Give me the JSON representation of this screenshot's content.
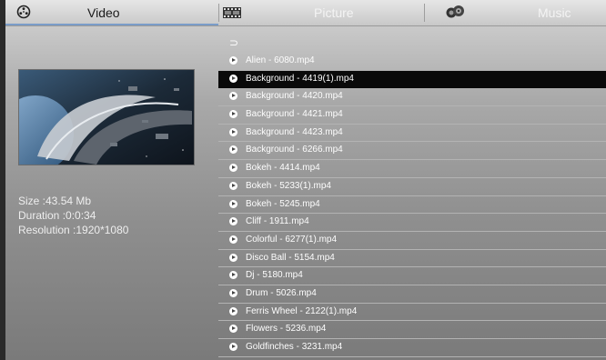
{
  "tabs": [
    {
      "label": "Video",
      "icon": "film-reel-icon",
      "active": true
    },
    {
      "label": "Picture",
      "icon": "film-strip-icon",
      "active": false
    },
    {
      "label": "Music",
      "icon": "speaker-icon",
      "active": false
    }
  ],
  "back_glyph": "⊃",
  "files": [
    "Alien - 6080.mp4",
    "Background - 4419(1).mp4",
    "Background - 4420.mp4",
    "Background - 4421.mp4",
    "Background - 4423.mp4",
    "Background - 6266.mp4",
    "Bokeh - 4414.mp4",
    "Bokeh - 5233(1).mp4",
    "Bokeh - 5245.mp4",
    "Cliff - 1911.mp4",
    "Colorful - 6277(1).mp4",
    "Disco Ball - 5154.mp4",
    "Dj - 5180.mp4",
    "Drum - 5026.mp4",
    "Ferris Wheel - 2122(1).mp4",
    "Flowers - 5236.mp4",
    "Goldfinches - 3231.mp4"
  ],
  "selected_index": 1,
  "details": {
    "size": "Size :43.54 Mb",
    "duration": "Duration :0:0:34",
    "resolution": "Resolution :1920*1080"
  },
  "colors": {
    "accent_underline": "#7a9cc8",
    "selected_row": "#0a0a0a"
  }
}
